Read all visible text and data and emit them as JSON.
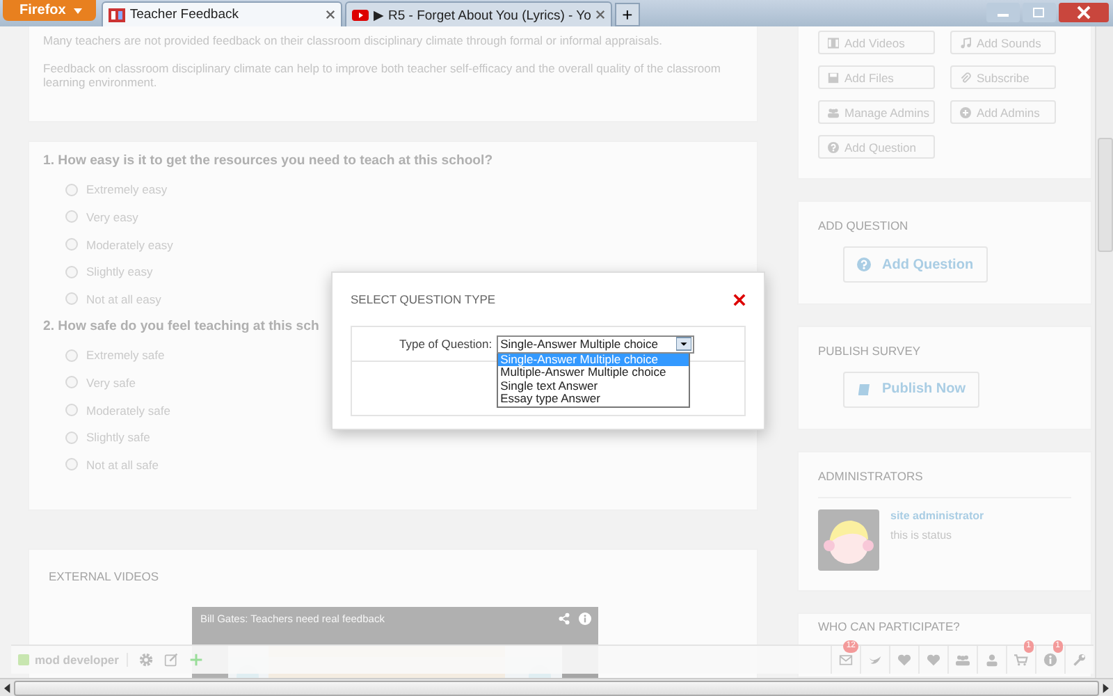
{
  "browser": {
    "menu_button": "Firefox",
    "tabs": [
      {
        "title": "Teacher Feedback",
        "selected": true
      },
      {
        "title": "▶ R5 - Forget About You (Lyrics) - Yo",
        "selected": false
      }
    ],
    "new_tab": "+"
  },
  "intro": {
    "paragraphs": [
      "Many teachers are not provided feedback on their classroom disciplinary climate through formal or informal appraisals.",
      "Feedback on classroom disciplinary climate can help to improve both teacher self-efficacy and the overall quality of the classroom learning environment."
    ]
  },
  "questions": [
    {
      "title": "1. How easy is it to get the resources you need to teach at this school?",
      "options": [
        {
          "label": "Extremely easy",
          "selected": false
        },
        {
          "label": "Very easy",
          "selected": false
        },
        {
          "label": "Moderately easy",
          "selected": false
        },
        {
          "label": "Slightly easy",
          "selected": false
        },
        {
          "label": "Not at all easy",
          "selected": false
        }
      ]
    },
    {
      "title": "2. How safe do you feel teaching at this sch",
      "options": [
        {
          "label": "Extremely safe",
          "selected": false
        },
        {
          "label": "Very safe",
          "selected": false
        },
        {
          "label": "Moderately safe",
          "selected": false
        },
        {
          "label": "Slightly safe",
          "selected": false
        },
        {
          "label": "Not at all safe",
          "selected": false
        }
      ]
    }
  ],
  "external_videos": {
    "heading": "EXTERNAL VIDEOS",
    "video": {
      "title": "Bill Gates: Teachers need real feedback",
      "kind": "picture"
    }
  },
  "sidebar": {
    "actions": [
      "Add Videos",
      "Add Sounds",
      "Add Files",
      "Subscribe",
      "Manage Admins",
      "Add Admins",
      "Add Question"
    ],
    "add_question": {
      "heading": "ADD QUESTION",
      "button": "Add Question"
    },
    "publish": {
      "heading": "PUBLISH SURVEY",
      "button": "Publish Now"
    },
    "administrators": {
      "heading": "ADMINISTRATORS",
      "name": "site administrator",
      "status": "this is status"
    },
    "participants": {
      "heading": "WHO CAN PARTICIPATE?"
    }
  },
  "modal": {
    "title": "SELECT QUESTION TYPE",
    "field_label": "Type of Question:",
    "value": "Single-Answer Multiple choice",
    "options": [
      {
        "label": "Single-Answer Multiple choice",
        "selected": true
      },
      {
        "label": "Multiple-Answer Multiple choice",
        "selected": false
      },
      {
        "label": "Single text Answer",
        "selected": false
      },
      {
        "label": "Essay type Answer",
        "selected": false
      }
    ]
  },
  "toolbar": {
    "user": "mod developer",
    "badges": [
      "12",
      "1",
      "1"
    ]
  }
}
